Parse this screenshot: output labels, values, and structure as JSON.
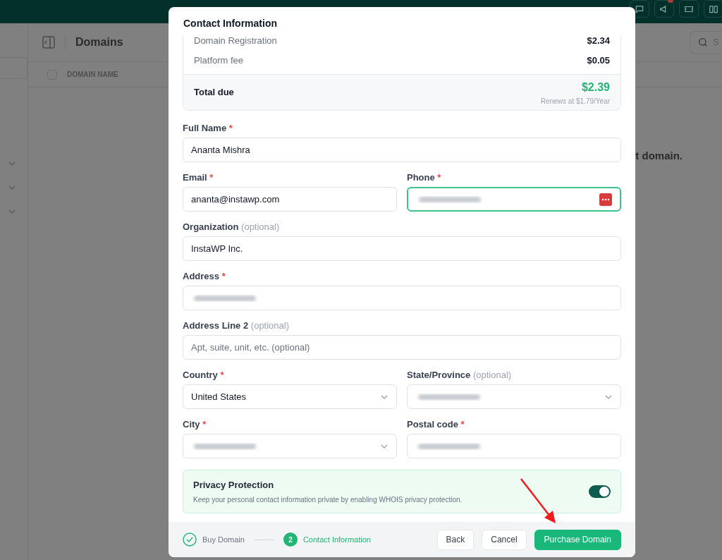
{
  "background": {
    "page_title": "Domains",
    "table_header": "DOMAIN NAME",
    "empty_text": "t domain.",
    "search_placeholder": "S",
    "select_all_checked": false,
    "toolbar_icons": [
      {
        "kind": "chat",
        "badge": false
      },
      {
        "kind": "megaphone",
        "badge": true
      },
      {
        "kind": "ticket",
        "badge": false
      },
      {
        "kind": "book",
        "badge": false
      }
    ]
  },
  "modal": {
    "title": "Contact Information",
    "summary": {
      "lines": [
        {
          "label": "Domain Registration",
          "amount": "$2.34"
        },
        {
          "label": "Platform fee",
          "amount": "$0.05"
        }
      ],
      "total_label": "Total due",
      "total": "$2.39",
      "renewal": "Renews at $1.79/Year"
    },
    "rows": [
      [
        {
          "label": "Full Name",
          "required": "*",
          "kind": "text",
          "value": "Ananta Mishra",
          "blurred": false,
          "focused": false
        }
      ],
      [
        {
          "label": "Email",
          "required": "*",
          "kind": "text",
          "value": "ananta@instawp.com",
          "blurred": false,
          "focused": false
        },
        {
          "label": "Phone",
          "required": "*",
          "kind": "text",
          "blurred": true,
          "focused": true,
          "password_manager": true
        }
      ],
      [
        {
          "label": "Organization",
          "optional_note": "(optional)",
          "kind": "text",
          "value": "InstaWP Inc.",
          "blurred": false,
          "focused": false
        }
      ],
      [
        {
          "label": "Address",
          "required": "*",
          "kind": "text",
          "blurred": true,
          "focused": false
        }
      ],
      [
        {
          "label": "Address Line 2",
          "optional_note": "(optional)",
          "kind": "text",
          "placeholder": "Apt, suite, unit, etc. (optional)",
          "blurred": false,
          "focused": false
        }
      ],
      [
        {
          "label": "Country",
          "required": "*",
          "kind": "select",
          "value": "United States",
          "blurred": false,
          "focused": false
        },
        {
          "label": "State/Province",
          "optional_note": "(optional)",
          "kind": "select",
          "blurred": true,
          "focused": false
        }
      ],
      [
        {
          "label": "City",
          "required": "*",
          "kind": "select",
          "blurred": true,
          "focused": false
        },
        {
          "label": "Postal code",
          "required": "*",
          "kind": "text",
          "blurred": true,
          "focused": false
        }
      ]
    ],
    "privacy": {
      "title": "Privacy Protection",
      "description": "Keep your personal contact information private by enabling WHOIS privacy protection.",
      "on": true
    },
    "steps": [
      {
        "label": "Buy Domain",
        "done": true,
        "selected": false
      },
      {
        "label": "Contact Information",
        "number": "2",
        "done": false,
        "selected": true
      }
    ],
    "buttons": [
      {
        "label": "Back",
        "kind": "secondary"
      },
      {
        "label": "Cancel",
        "kind": "secondary"
      },
      {
        "label": "Purchase Domain",
        "kind": "primary"
      }
    ]
  }
}
